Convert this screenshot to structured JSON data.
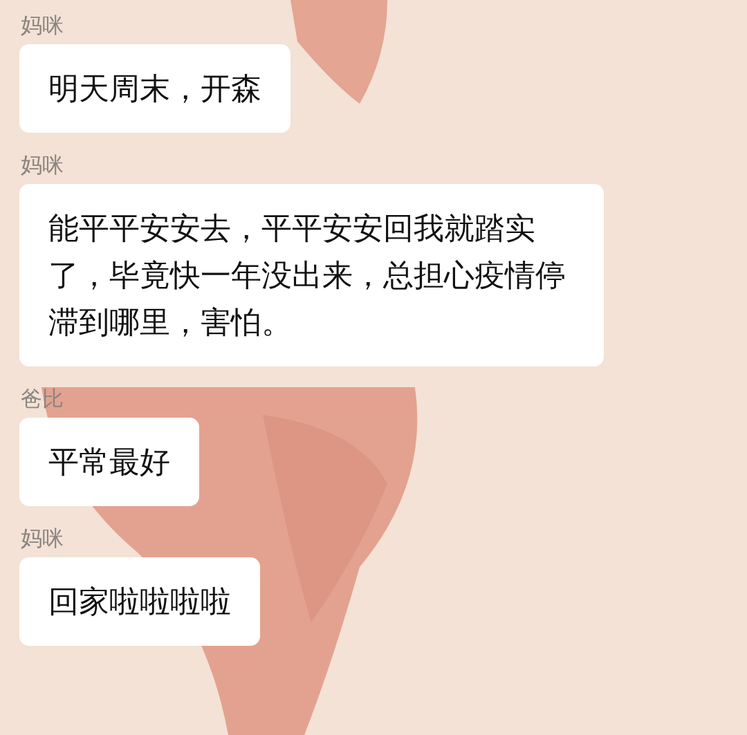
{
  "messages": [
    {
      "sender": "妈咪",
      "text": "明天周末，开森"
    },
    {
      "sender": "妈咪",
      "text": "能平平安安去，平平安安回我就踏实了，毕竟快一年没出来，总担心疫情停滞到哪里，害怕。"
    },
    {
      "sender": "爸比",
      "text": "平常最好"
    },
    {
      "sender": "妈咪",
      "text": "回家啦啦啦啦"
    }
  ]
}
